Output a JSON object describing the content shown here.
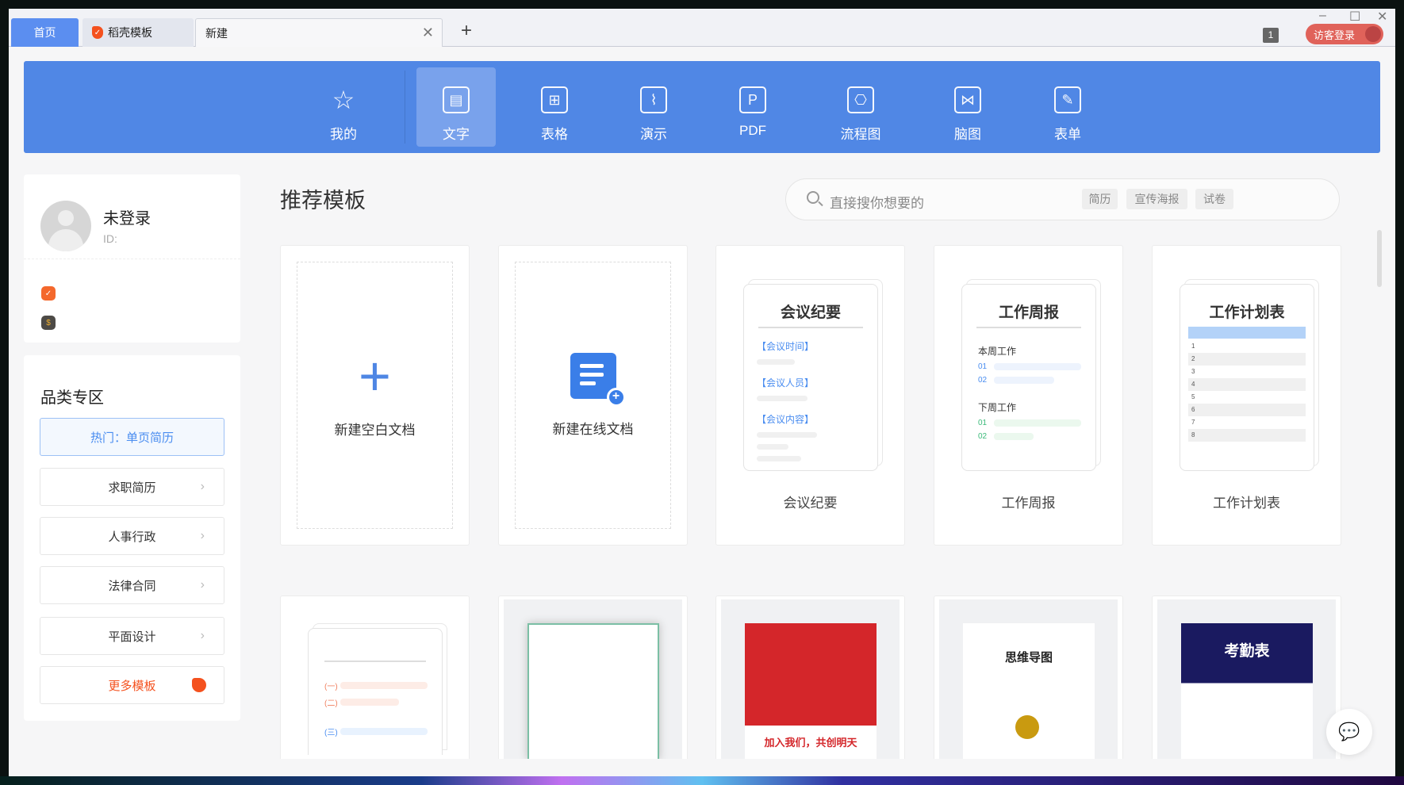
{
  "tabs": [
    {
      "label": "首页"
    },
    {
      "label": "稻壳模板"
    },
    {
      "label": "新建"
    }
  ],
  "window": {
    "badge": "1",
    "login": "访客登录",
    "min": "–",
    "max": "☐",
    "close": "✕",
    "new_tab": "+",
    "tab_close": "✕"
  },
  "categories": [
    {
      "label": "我的",
      "icon": "☆"
    },
    {
      "label": "文字",
      "icon": "▤"
    },
    {
      "label": "表格",
      "icon": "⊞"
    },
    {
      "label": "演示",
      "icon": "⌇"
    },
    {
      "label": "PDF",
      "icon": "P"
    },
    {
      "label": "流程图",
      "icon": "⎔"
    },
    {
      "label": "脑图",
      "icon": "⋈"
    },
    {
      "label": "表单",
      "icon": "✎"
    }
  ],
  "user": {
    "name": "未登录",
    "id": "ID:"
  },
  "sidebar": {
    "title": "品类专区",
    "hot": "热门：单页简历",
    "items": [
      "求职简历",
      "人事行政",
      "法律合同",
      "平面设计"
    ],
    "more": "更多模板"
  },
  "main": {
    "title": "推荐模板",
    "search_placeholder": "直接搜你想要的",
    "tags": [
      "简历",
      "宣传海报",
      "试卷"
    ]
  },
  "templates": {
    "blank": "新建空白文档",
    "online": "新建在线文档",
    "meeting": {
      "title": "会议纪要",
      "fields": [
        "【会议时间】",
        "【会议人员】",
        "【会议内容】"
      ],
      "name": "会议纪要"
    },
    "weekly": {
      "title": "工作周报",
      "this_week": "本周工作",
      "next_week": "下周工作",
      "nums": [
        "01",
        "02"
      ],
      "name": "工作周报"
    },
    "plan": {
      "title": "工作计划表",
      "rows": [
        "1",
        "2",
        "3",
        "4",
        "5",
        "6",
        "7",
        "8"
      ],
      "name": "工作计划表"
    },
    "row2": {
      "list": [
        "(一)",
        "(二)",
        "(三)"
      ],
      "poster": "加入我们，共创明天",
      "mindmap": "思维导图",
      "attendance": "考勤表"
    }
  },
  "colors": {
    "accent": "#5087e5",
    "brand": "#f4511e",
    "login": "#e0625a"
  }
}
